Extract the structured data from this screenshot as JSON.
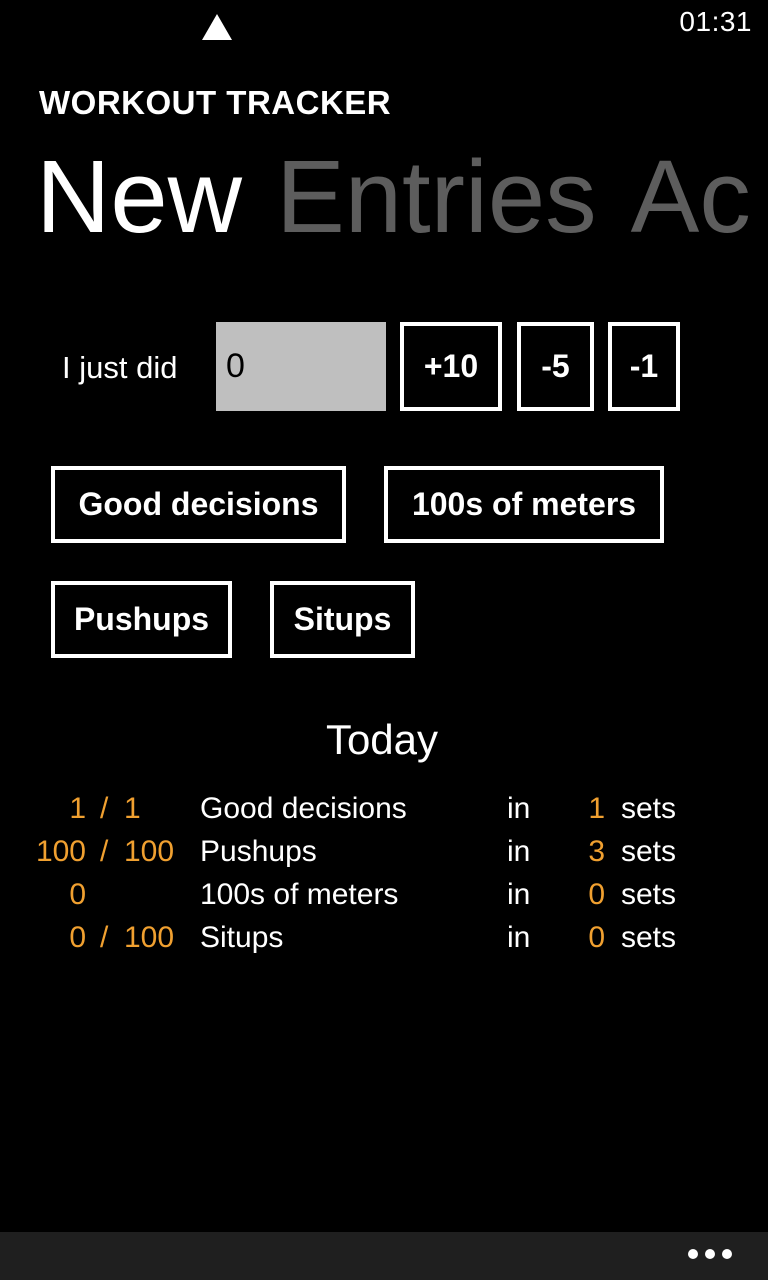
{
  "status_bar": {
    "signal_icon": "signal-strength-icon",
    "time": "01:31"
  },
  "app": {
    "title": "WORKOUT TRACKER"
  },
  "pivot": {
    "tabs": [
      {
        "label": "New",
        "active": true
      },
      {
        "label": "Entries",
        "active": false
      },
      {
        "label": "Ac",
        "active": false
      }
    ]
  },
  "entry": {
    "label": "I just did",
    "value": "0",
    "increments": [
      "+10",
      "-5",
      "-1"
    ]
  },
  "activities": [
    "Good decisions",
    "100s of meters",
    "Pushups",
    "Situps"
  ],
  "today": {
    "heading": "Today",
    "rows": [
      {
        "done": "1",
        "slash": "/",
        "goal": "1",
        "name": "Good decisions",
        "in": "in",
        "sets": "1",
        "sets_label": "sets"
      },
      {
        "done": "100",
        "slash": "/",
        "goal": "100",
        "name": "Pushups",
        "in": "in",
        "sets": "3",
        "sets_label": "sets"
      },
      {
        "done": "0",
        "slash": "",
        "goal": "",
        "name": "100s of meters",
        "in": "in",
        "sets": "0",
        "sets_label": "sets"
      },
      {
        "done": "0",
        "slash": "/",
        "goal": "100",
        "name": "Situps",
        "in": "in",
        "sets": "0",
        "sets_label": "sets"
      }
    ]
  },
  "app_bar": {
    "more_icon": "more-ellipsis-icon"
  },
  "colors": {
    "accent": "#f0a030",
    "inactive_tab": "#5d5d5d",
    "input_bg": "#bfbfbf",
    "app_bar_bg": "#1f1f1f"
  }
}
